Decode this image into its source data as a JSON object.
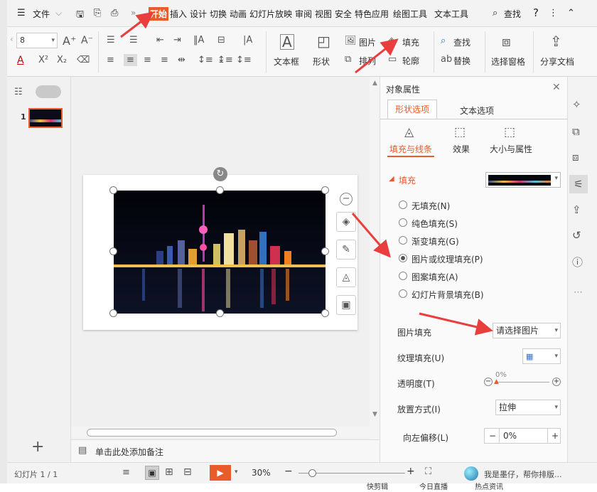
{
  "menubar": {
    "file_label": "文件",
    "tabs": [
      "开始",
      "插入",
      "设计",
      "切换",
      "动画",
      "幻灯片放映",
      "审阅",
      "视图",
      "安全",
      "特色应用",
      "绘图工具",
      "文本工具"
    ],
    "active_tab": "开始",
    "search_label": "查找",
    "help_label": "?"
  },
  "ribbon": {
    "font_size_value": "8",
    "textbox_label": "文本框",
    "shape_label": "形状",
    "picture_label": "图片",
    "arrange_label": "排列",
    "fill_label": "填充",
    "outline_label": "轮廓",
    "find_label": "查找",
    "replace_label": "替换",
    "selection_pane_label": "选择窗格",
    "share_label": "分享文档"
  },
  "thumbnails": {
    "slide_number": "1"
  },
  "notes": {
    "placeholder": "单击此处添加备注"
  },
  "props": {
    "title": "对象属性",
    "tabs": [
      "形状选项",
      "文本选项"
    ],
    "active_tab": "形状选项",
    "subtabs": [
      "填充与线条",
      "效果",
      "大小与属性"
    ],
    "active_subtab": "填充与线条",
    "fill_section": "填充",
    "fill_options": [
      {
        "label": "无填充(N)",
        "selected": false
      },
      {
        "label": "纯色填充(S)",
        "selected": false
      },
      {
        "label": "渐变填充(G)",
        "selected": false
      },
      {
        "label": "图片或纹理填充(P)",
        "selected": true
      },
      {
        "label": "图案填充(A)",
        "selected": false
      },
      {
        "label": "幻灯片背景填充(B)",
        "selected": false
      }
    ],
    "picture_fill_label": "图片填充",
    "picture_fill_value": "请选择图片",
    "texture_fill_label": "纹理填充(U)",
    "transparency_label": "透明度(T)",
    "transparency_value": "0%",
    "placement_label": "放置方式(I)",
    "placement_value": "拉伸",
    "offset_left_label": "向左偏移(L)",
    "offset_left_value": "0%"
  },
  "statusbar": {
    "slide_info": "幻灯片 1 / 1",
    "zoom": "30%",
    "assistant": "我是墨仔，帮你排版..."
  },
  "bottom": {
    "items": [
      "快剪辑",
      "今日直播",
      "热点资讯"
    ]
  },
  "colors": {
    "accent": "#e85b2a",
    "annotation_arrow": "#e83e3e"
  }
}
